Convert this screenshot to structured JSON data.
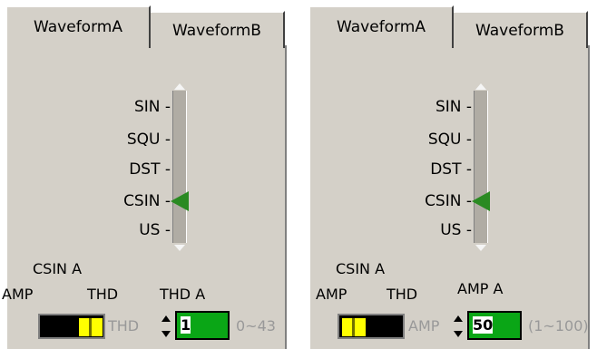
{
  "tabs": [
    {
      "active": "WaveformA",
      "inactive": "WaveformB"
    },
    {
      "active": "WaveformA",
      "inactive": "WaveformB"
    }
  ],
  "slider_labels": [
    "SIN -",
    "SQU -",
    "DST -",
    "CSIN -",
    "US -"
  ],
  "left_panel": {
    "slider_selected": "CSIN",
    "section_title": "CSIN A",
    "amp_label": "AMP",
    "thd_label": "THD",
    "switch_hint": "THD",
    "switch_state": "THD",
    "numeric_label": "THD A",
    "numeric_value": "1",
    "range_text": "0~43"
  },
  "right_panel": {
    "slider_selected": "CSIN",
    "section_title": "CSIN A",
    "amp_label": "AMP",
    "thd_label": "THD",
    "switch_hint": "AMP",
    "switch_state": "AMP",
    "numeric_label": "AMP A",
    "numeric_value": "50",
    "range_text": "(1~100)"
  },
  "colors": {
    "panel_bg": "#d4d0c8",
    "pointer": "#2a8a22",
    "numeric_bg": "#0aa616",
    "switch_on": "#ffff00",
    "switch_off": "#000000"
  }
}
